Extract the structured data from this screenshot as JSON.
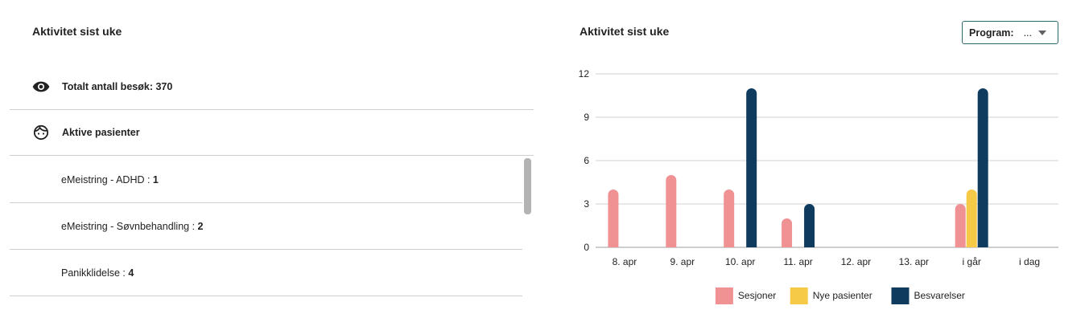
{
  "left": {
    "title": "Aktivitet sist uke",
    "total_visits": {
      "icon": "eye-icon",
      "label": "Totalt antall besøk: 370"
    },
    "active_patients": {
      "icon": "face-icon",
      "label": "Aktive pasienter"
    },
    "programs": [
      {
        "name": "eMeistring - ADHD : ",
        "count": "1"
      },
      {
        "name": "eMeistring - Søvnbehandling : ",
        "count": "2"
      },
      {
        "name": "Panikklidelse : ",
        "count": "4"
      }
    ]
  },
  "right": {
    "title": "Aktivitet sist uke",
    "program_filter": {
      "label": "Program:",
      "value": "..."
    }
  },
  "chart_data": {
    "type": "bar",
    "categories": [
      "8. apr",
      "9. apr",
      "10. apr",
      "11. apr",
      "12. apr",
      "13. apr",
      "i går",
      "i dag"
    ],
    "series": [
      {
        "name": "Sesjoner",
        "color": "#f09193",
        "values": [
          4,
          5,
          4,
          2,
          0,
          0,
          3,
          0
        ]
      },
      {
        "name": "Nye pasienter",
        "color": "#f6c946",
        "values": [
          0,
          0,
          0,
          0,
          0,
          0,
          4,
          0
        ]
      },
      {
        "name": "Besvarelser",
        "color": "#0f3b5e",
        "values": [
          0,
          0,
          11,
          3,
          0,
          0,
          11,
          0
        ]
      }
    ],
    "y_ticks": [
      "0",
      "3",
      "6",
      "9",
      "12"
    ],
    "ylim": [
      0,
      12
    ],
    "grid": true,
    "legend_position": "bottom"
  }
}
